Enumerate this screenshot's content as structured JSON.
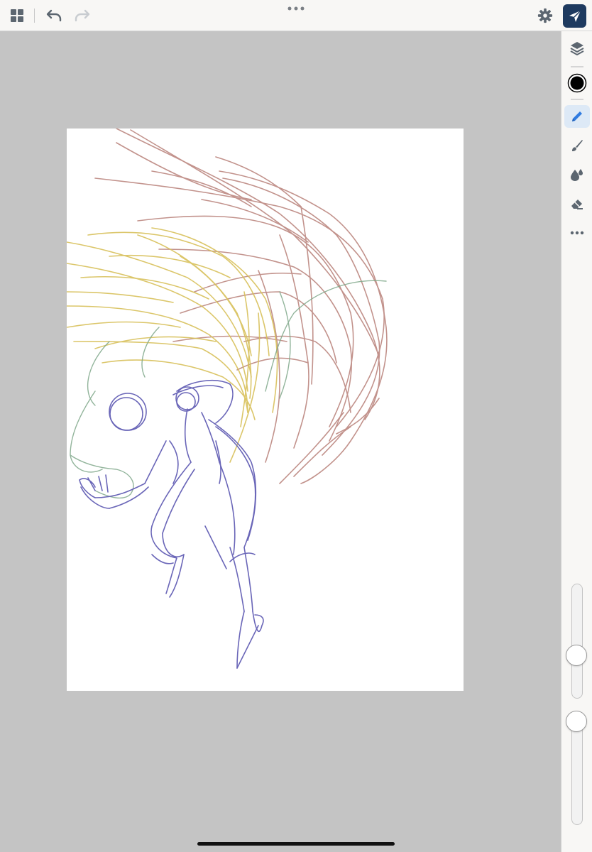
{
  "app": {
    "accent_color": "#1e3a5f",
    "canvas_background": "#ffffff",
    "workspace_color": "#c4c4c4"
  },
  "toolbar": {
    "gallery_icon": "gallery-grid-icon",
    "undo_icon": "undo-icon",
    "redo_icon": "redo-icon",
    "more_icon": "more-horizontal-icon",
    "settings_icon": "gear-icon",
    "share_icon": "send-icon"
  },
  "tools": {
    "layers_icon": "layers-icon",
    "color_swatch": "#000000",
    "items": [
      {
        "name": "pencil",
        "icon": "pencil-icon",
        "active": true
      },
      {
        "name": "brush",
        "icon": "brush-icon",
        "active": false
      },
      {
        "name": "watercolor",
        "icon": "water-drop-icon",
        "active": false
      },
      {
        "name": "eraser",
        "icon": "eraser-icon",
        "active": false
      },
      {
        "name": "more",
        "icon": "more-horizontal-icon",
        "active": false
      }
    ],
    "brush_size_level": 0.35,
    "opacity_level": 1.0
  },
  "sketch": {
    "stroke_colors": {
      "figure": "#6a66b8",
      "wing": "#b88078",
      "hair": "#d8c05a",
      "outline": "#7fa88a"
    }
  }
}
